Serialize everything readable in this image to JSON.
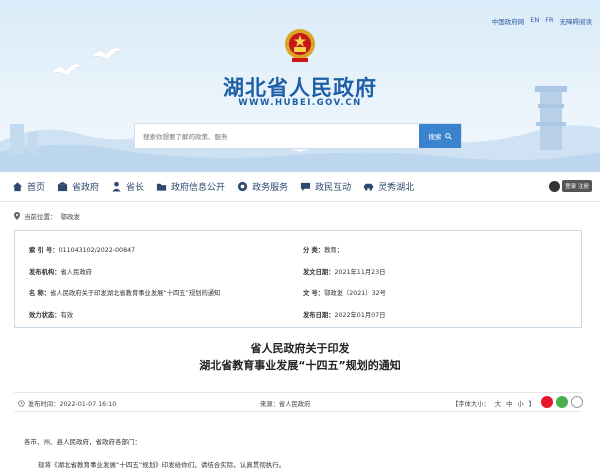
{
  "header": {
    "top_links": [
      "中国政府网",
      "EN",
      "FR",
      "无障碍阅读"
    ],
    "site_title": "湖北省人民政府",
    "site_url": "WWW.HUBEI.GOV.CN",
    "search_placeholder": "搜索你想要了解的政策、服务",
    "search_button": "搜索"
  },
  "nav": {
    "items": [
      {
        "label": "首页",
        "icon": "home-icon"
      },
      {
        "label": "省政府",
        "icon": "building-icon"
      },
      {
        "label": "省长",
        "icon": "person-icon"
      },
      {
        "label": "政府信息公开",
        "icon": "folder-icon"
      },
      {
        "label": "政务服务",
        "icon": "service-icon"
      },
      {
        "label": "政民互动",
        "icon": "chat-icon"
      },
      {
        "label": "灵秀湖北",
        "icon": "car-icon"
      }
    ],
    "login_label": "登录 注册"
  },
  "breadcrumb": {
    "prefix": "当前位置：",
    "current": "鄂政发"
  },
  "meta": {
    "index_key": "索 引 号：",
    "index_val": "011043102/2022-00847",
    "category_key": "分 类：",
    "category_val": "教育；",
    "publisher_key": "发布机构：",
    "publisher_val": "省人民政府",
    "date_key": "发文日期：",
    "date_val": "2021年11月23日",
    "name_key": "名 称：",
    "name_val": "省人民政府关于印发湖北省教育事业发展“十四五”规划的通知",
    "docno_key": "文 号：",
    "docno_val": "鄂政发〔2021〕32号",
    "status_key": "效力状态：",
    "status_val": "有效",
    "pubdate_key": "发布日期：",
    "pubdate_val": "2022年01月07日"
  },
  "title": {
    "line1": "省人民政府关于印发",
    "line2": "湖北省教育事业发展“十四五”规划的通知"
  },
  "infobar": {
    "time_label": "发布时间：2022-01-07 16:10",
    "source_label": "来源：省人民政府",
    "font_label": "【字体大小：",
    "font_sizes": [
      "大",
      "中",
      "小"
    ],
    "font_close": "】"
  },
  "body": {
    "para1": "各市、州、县人民政府，省政府各部门：",
    "para2": "现将《湖北省教育事业发展“十四五”规划》印发给你们，请结合实际，认真贯彻执行。"
  },
  "colors": {
    "brand_blue": "#1d5fa8",
    "search_blue": "#3b83cf",
    "nav_text": "#2b4a6e"
  }
}
